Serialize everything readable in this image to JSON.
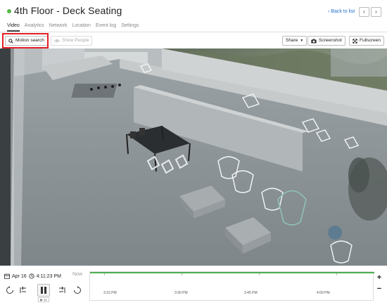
{
  "camera": {
    "title": "4th Floor - Deck Seating",
    "status_color": "#57b846"
  },
  "header": {
    "back_label": "Back to list",
    "prev_icon": "chevron-left",
    "next_icon": "chevron-right"
  },
  "tabs": [
    {
      "label": "Video",
      "active": true
    },
    {
      "label": "Analytics",
      "active": false
    },
    {
      "label": "Network",
      "active": false
    },
    {
      "label": "Location",
      "active": false
    },
    {
      "label": "Event log",
      "active": false
    },
    {
      "label": "Settings",
      "active": false
    }
  ],
  "toolbar": {
    "motion_search_label": "Motion search",
    "show_people_label": "Show People",
    "share_label": "Share",
    "screenshot_label": "Screenshot",
    "fullscreen_label": "Fullscreen",
    "highlight_color": "#e41f26"
  },
  "playback": {
    "date": "Apr 16",
    "time": "4:11:23 PM",
    "now_label": "Now",
    "speed": "▶ 1x",
    "accent_color": "#4caf50"
  },
  "timeline": {
    "ticks": [
      "3:15 PM",
      "3:30 PM",
      "3:45 PM",
      "4:00 PM"
    ]
  }
}
